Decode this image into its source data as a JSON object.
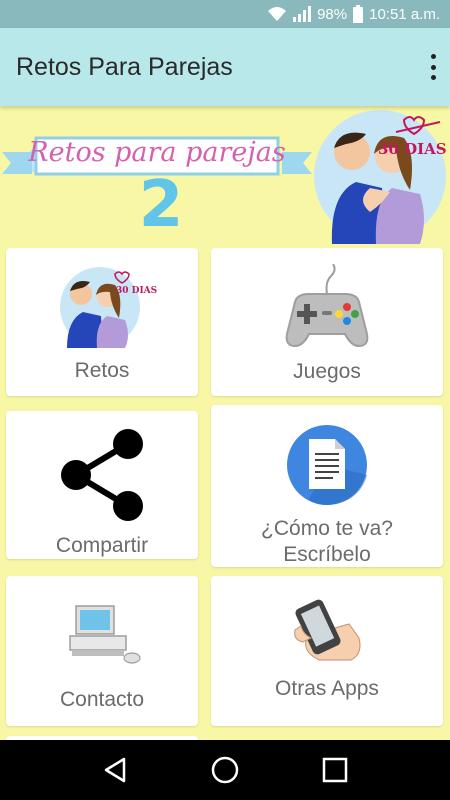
{
  "status_bar": {
    "battery": "98%",
    "time": "10:51 a.m."
  },
  "app_bar": {
    "title": "Retos Para Parejas"
  },
  "banner": {
    "title": "Retos para parejas",
    "number": "2",
    "days": "30 DIAS"
  },
  "menu": {
    "retos": {
      "label": "Retos",
      "days": "30 DIAS"
    },
    "juegos": {
      "label": "Juegos"
    },
    "compartir": {
      "label": "Compartir"
    },
    "como_te_va": {
      "label_line1": "¿Cómo te va?",
      "label_line2": "Escríbelo"
    },
    "contacto": {
      "label": "Contacto"
    },
    "otras_apps": {
      "label": "Otras Apps"
    }
  },
  "colors": {
    "background": "#f7f7a6",
    "app_bar": "#b9e8eb",
    "status_bar": "#8ab9bd",
    "card": "#ffffff",
    "nav_bar": "#000000"
  },
  "icons": [
    "wifi-icon",
    "signal-icon",
    "battery-icon",
    "overflow-menu-icon",
    "couple-icon",
    "gamepad-icon",
    "share-icon",
    "document-icon",
    "computer-icon",
    "phone-hand-icon",
    "back-icon",
    "home-icon",
    "recents-icon"
  ]
}
